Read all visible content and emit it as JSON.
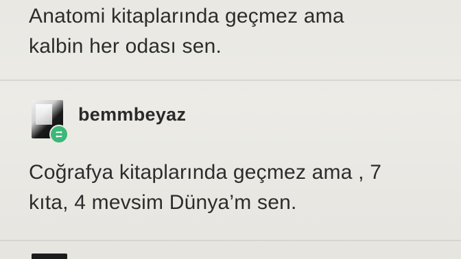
{
  "posts": [
    {
      "text_lines": [
        "Anatomi kitaplarında geçmez ama",
        "kalbin her odası sen."
      ]
    },
    {
      "username": "bemmbeyaz",
      "avatar_icon": "user-avatar",
      "badge_icon": "retweet-icon",
      "badge_color": "#3cb878",
      "text_lines": [
        "Coğrafya kitaplarında geçmez ama , 7",
        "kıta, 4 mevsim Dünya’m sen."
      ]
    }
  ],
  "colors": {
    "background": "#ebeae5",
    "divider": "#d6d5cf",
    "text": "#2c2c2c"
  }
}
